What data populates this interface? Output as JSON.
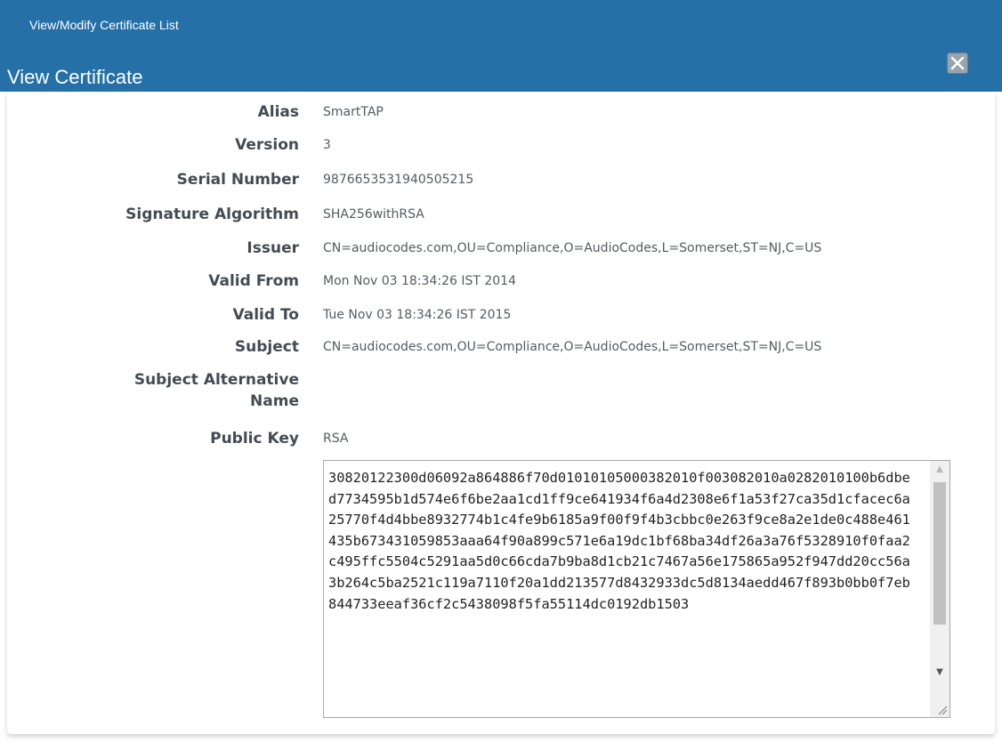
{
  "app": {
    "title": "View/Modify Certificate List"
  },
  "dialog": {
    "title": "View Certificate",
    "close_icon": "close-icon"
  },
  "fields": [
    {
      "label": "Alias",
      "value": "SmartTAP"
    },
    {
      "label": "Version",
      "value": "3"
    },
    {
      "label": "Serial Number",
      "value": "9876653531940505215"
    },
    {
      "label": "Signature Algorithm",
      "value": "SHA256withRSA"
    },
    {
      "label": "Issuer",
      "value": "CN=audiocodes.com,OU=Compliance,O=AudioCodes,L=Somerset,ST=NJ,C=US"
    },
    {
      "label": "Valid From",
      "value": "Mon Nov 03 18:34:26 IST 2014"
    },
    {
      "label": "Valid To",
      "value": "Tue Nov 03 18:34:26 IST 2015"
    },
    {
      "label": "Subject",
      "value": "CN=audiocodes.com,OU=Compliance,O=AudioCodes,L=Somerset,ST=NJ,C=US"
    },
    {
      "label": "Subject Alternative Name",
      "value": ""
    },
    {
      "label": "Public Key",
      "value": "RSA"
    }
  ],
  "public_key_hex": "30820122300d06092a864886f70d01010105000382010f003082010a0282010100b6dbed7734595b1d574e6f6be2aa1cd1ff9ce641934f6a4d2308e6f1a53f27ca35d1cfacec6a25770f4d4bbe8932774b1c4fe9b6185a9f00f9f4b3cbbc0e263f9ce8a2e1de0c488e461435b673431059853aaa64f90a899c571e6a19dc1bf68ba34df26a3a76f5328910f0faa2c495ffc5504c5291aa5d0c66cda7b9ba8d1cb21c7467a56e175865a952f947dd20cc56a3b264c5ba2521c119a7110f20a1dd213577d8432933dc5d8134aedd467f893b0bb0f7eb844733eeaf36cf2c5438098f5fa55114dc0192db1503",
  "colors": {
    "header_bg": "#2470a7",
    "label": "#444b52",
    "value": "#555b61"
  }
}
